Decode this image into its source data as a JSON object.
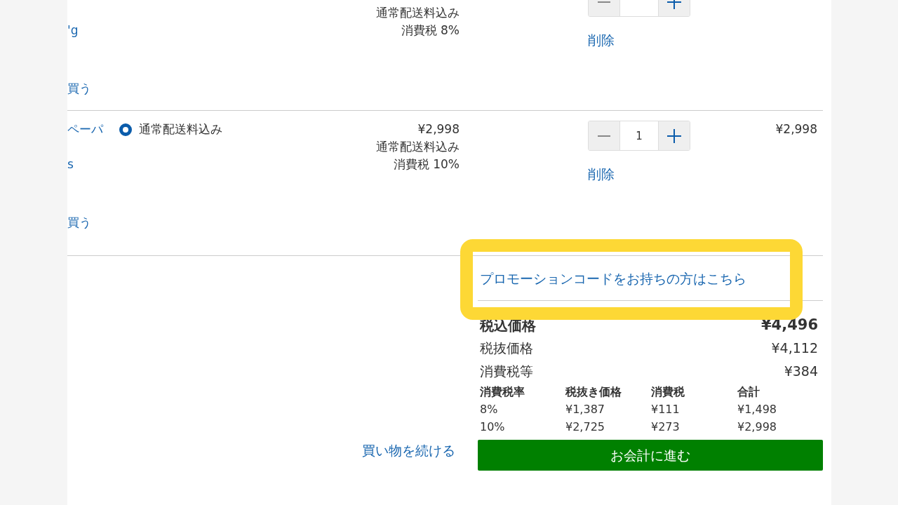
{
  "cart_items": [
    {
      "name_sub": "'g",
      "buy_link": "買う",
      "price_notes": [
        "通常配送料込み",
        "消費税 8%"
      ],
      "delete_link": "削除"
    },
    {
      "name": "ペーパ",
      "name_sub": "s",
      "buy_link": "買う",
      "shipping": {
        "label": "通常配送料込み",
        "selected": true
      },
      "price": "¥2,998",
      "price_notes": [
        "通常配送料込み",
        "消費税 10%"
      ],
      "quantity": "1",
      "delete_link": "削除",
      "total": "¥2,998"
    }
  ],
  "promo_link": "プロモーションコードをお持ちの方はこちら",
  "summary": [
    {
      "kind": "main",
      "label": "税込価格",
      "value": "¥4,496"
    },
    {
      "kind": "plain",
      "label": "税抜価格",
      "value": "¥4,112"
    },
    {
      "kind": "plain",
      "label": "消費税等",
      "value": "¥384"
    }
  ],
  "tax_table": {
    "columns": [
      "消費税率",
      "税抜き価格",
      "消費税",
      "合計"
    ],
    "rows": [
      [
        "8%",
        "¥1,387",
        "¥111",
        "¥1,498"
      ],
      [
        "10%",
        "¥2,725",
        "¥273",
        "¥2,998"
      ]
    ]
  },
  "continue_link": "買い物を続ける",
  "checkout_button": "お会計に進む"
}
